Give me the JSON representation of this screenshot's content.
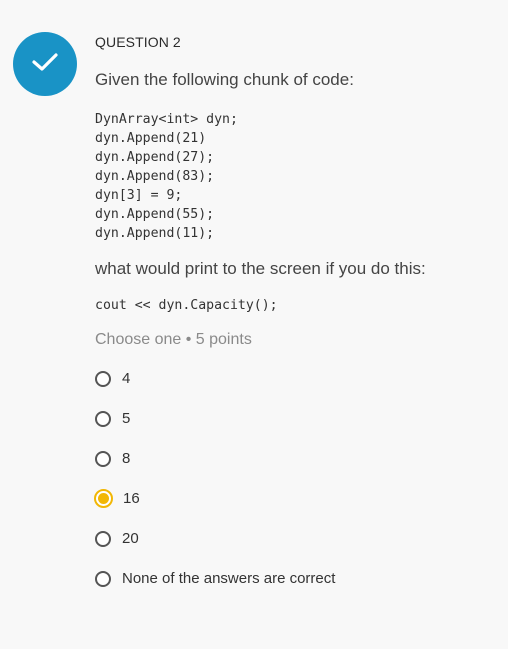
{
  "question": {
    "label": "QUESTION 2",
    "status_icon": "check-icon",
    "status_color": "#1993c6",
    "prompt": "Given the following chunk of code:",
    "code_lines": [
      "DynArray<int> dyn;",
      "dyn.Append(21)",
      "dyn.Append(27);",
      "dyn.Append(83);",
      "dyn[3] = 9;",
      "dyn.Append(55);",
      "dyn.Append(11);"
    ],
    "question_text": "what would print to the screen if you do this:",
    "code_call": "cout << dyn.Capacity();",
    "instruction": "Choose one • 5 points",
    "selected_color": "#f2b705",
    "options": [
      {
        "label": "4",
        "selected": false
      },
      {
        "label": "5",
        "selected": false
      },
      {
        "label": "8",
        "selected": false
      },
      {
        "label": "16",
        "selected": true
      },
      {
        "label": "20",
        "selected": false
      },
      {
        "label": "None of the answers are correct",
        "selected": false
      }
    ]
  }
}
